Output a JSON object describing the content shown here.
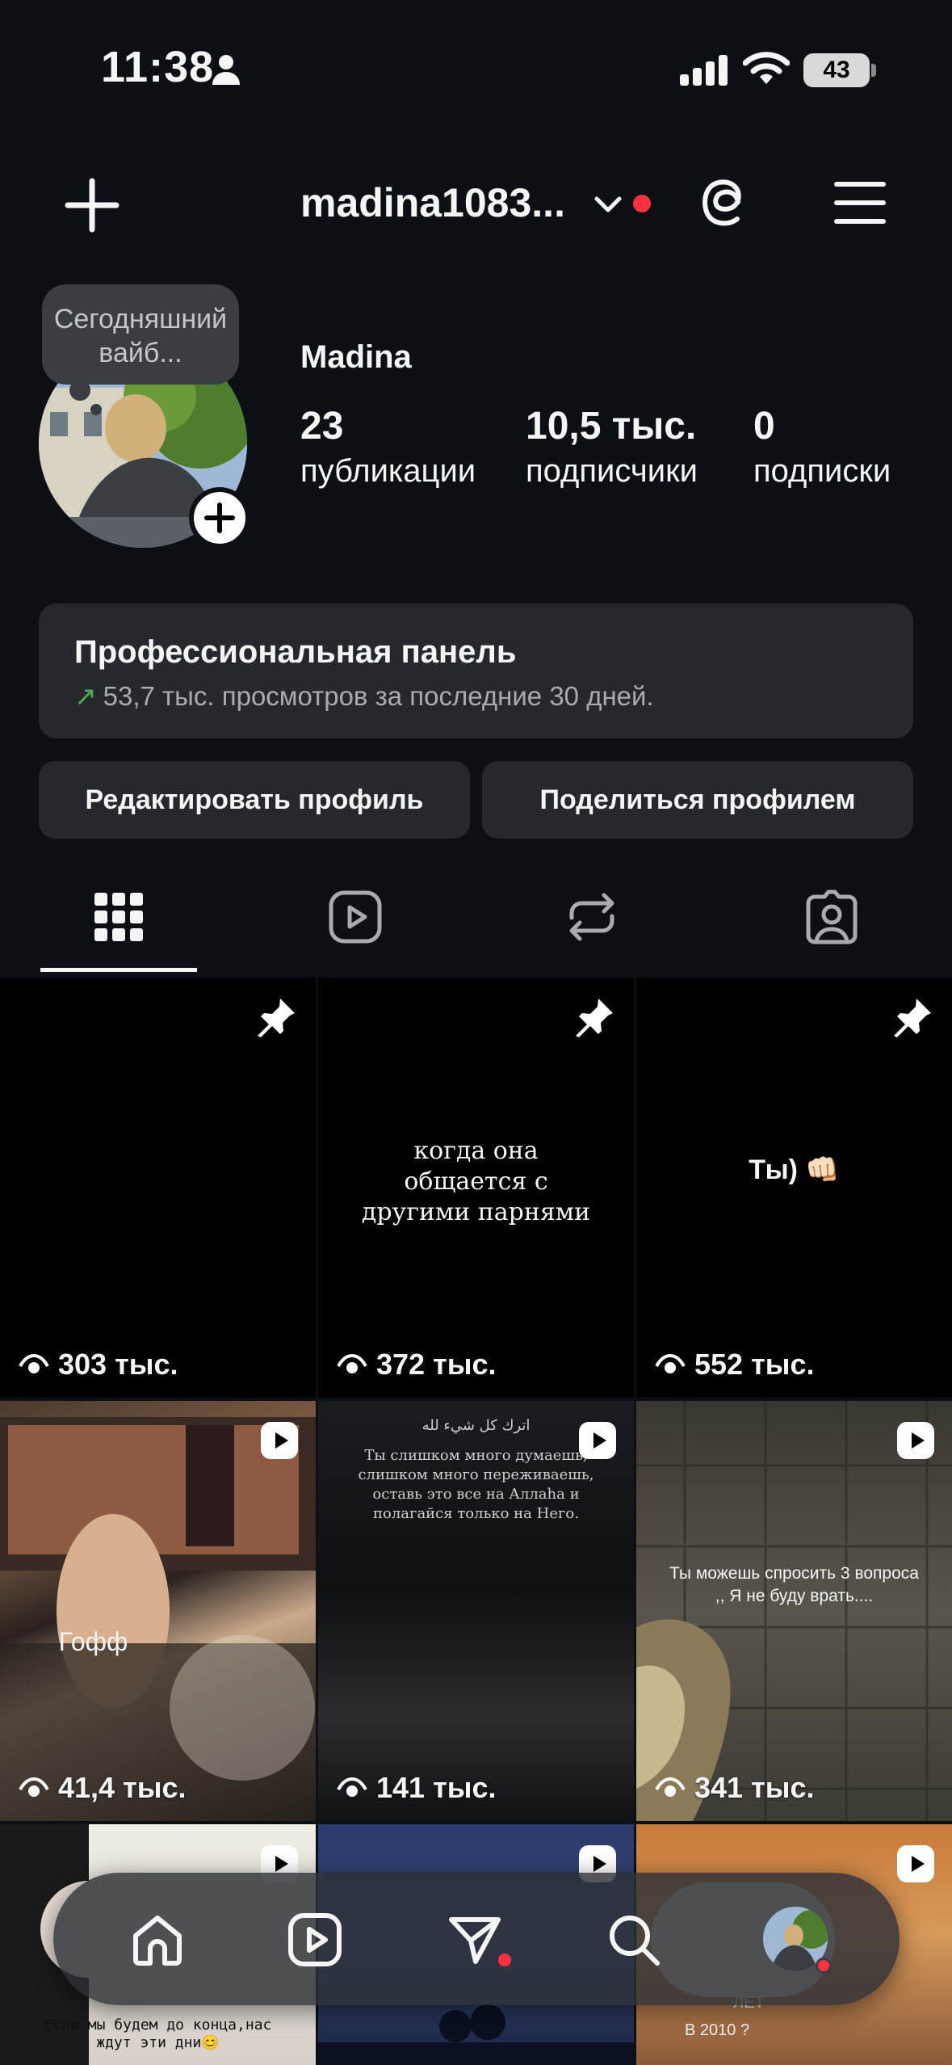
{
  "status_bar": {
    "time": "11:38",
    "battery": "43"
  },
  "header": {
    "username": "madina1083..."
  },
  "profile": {
    "note": "Сегодняшний вайб...",
    "name": "Madina",
    "stats": [
      {
        "num": "23",
        "label": "публикации"
      },
      {
        "num": "10,5 тыс.",
        "label": "подписчики"
      },
      {
        "num": "0",
        "label": "подписки"
      }
    ]
  },
  "pro_panel": {
    "title": "Профессиональная панель",
    "subtitle": "53,7 тыс. просмотров за последние 30 дней."
  },
  "buttons": {
    "edit": "Редактировать профиль",
    "share": "Поделиться профилем"
  },
  "posts": [
    {
      "views": "303 тыс.",
      "caption": "",
      "pinned": true
    },
    {
      "views": "372 тыс.",
      "caption": "когда она общается с другими парнями",
      "pinned": true
    },
    {
      "views": "552 тыс.",
      "caption": "Ты) 👊🏻",
      "pinned": true
    },
    {
      "views": "41,4 тыс.",
      "caption": "Гофф",
      "reel": true
    },
    {
      "views": "141 тыс.",
      "caption": "Ты слишком много думаешь, слишком много переживаешь, оставь это все на Аллаha и полагайся только на Него.",
      "top": "اترك كل شيء لله",
      "reel": true
    },
    {
      "views": "341 тыс.",
      "caption": "Ты можешь спросить 3 вопроса ,, Я не буду врать....",
      "reel": true
    },
    {
      "views": "",
      "caption": "Если мы будем до конца,нас ждут эти дни😊",
      "reel": true
    },
    {
      "views": "",
      "caption": "",
      "reel": true
    },
    {
      "views": "",
      "caption": "В 2010 ?",
      "extra": "ЛЕТ",
      "reel": true
    }
  ],
  "colors": {
    "background": "#0c1014",
    "panel": "#25292e",
    "accent_red": "#ff3040",
    "green": "#4caf50"
  }
}
